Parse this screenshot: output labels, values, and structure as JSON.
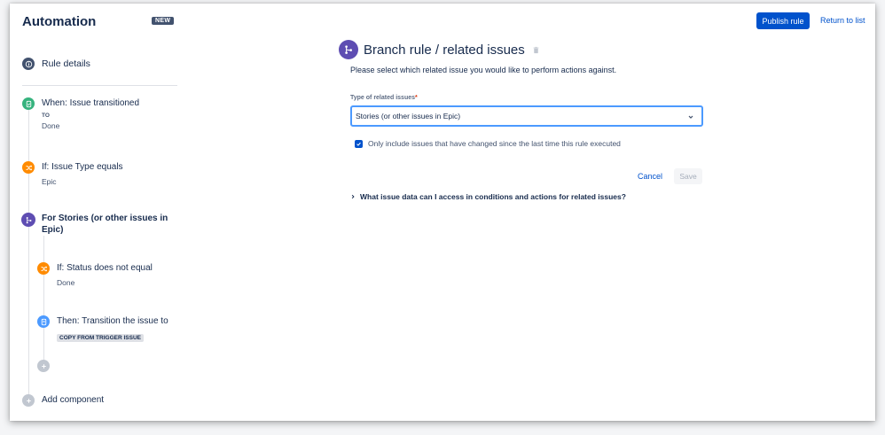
{
  "app": {
    "title": "Automation",
    "badge": "NEW"
  },
  "header": {
    "publish_label": "Publish rule",
    "return_label": "Return to list"
  },
  "sidebar": {
    "rule_details": "Rule details",
    "trigger": {
      "title": "When: Issue transitioned",
      "label": "TO",
      "value": "Done",
      "icon": "trigger-icon"
    },
    "condition": {
      "title": "If: Issue Type equals",
      "value": "Epic",
      "icon": "condition-icon"
    },
    "branch": {
      "title": "For Stories (or other issues in Epic)",
      "icon": "branch-icon"
    },
    "branch_condition": {
      "title": "If: Status does not equal",
      "value": "Done",
      "icon": "condition-icon"
    },
    "branch_action": {
      "title": "Then: Transition the issue to",
      "chip": "COPY FROM TRIGGER ISSUE",
      "icon": "action-icon"
    },
    "add_component": "Add component"
  },
  "main": {
    "title": "Branch rule / related issues",
    "description": "Please select which related issue you would like to perform actions against.",
    "field_label": "Type of related issues",
    "field_required": "*",
    "selected_value": "Stories (or other issues in Epic)",
    "checkbox_label": "Only include issues that have changed since the last time this rule executed",
    "checkbox_checked": true,
    "cancel_label": "Cancel",
    "save_label": "Save",
    "faq_label": "What issue data can I access in conditions and actions for related issues?"
  },
  "colors": {
    "primary": "#0052cc",
    "branch": "#5e4db2",
    "trigger": "#36b37e",
    "condition": "#ff8b00",
    "action": "#4c9aff"
  }
}
